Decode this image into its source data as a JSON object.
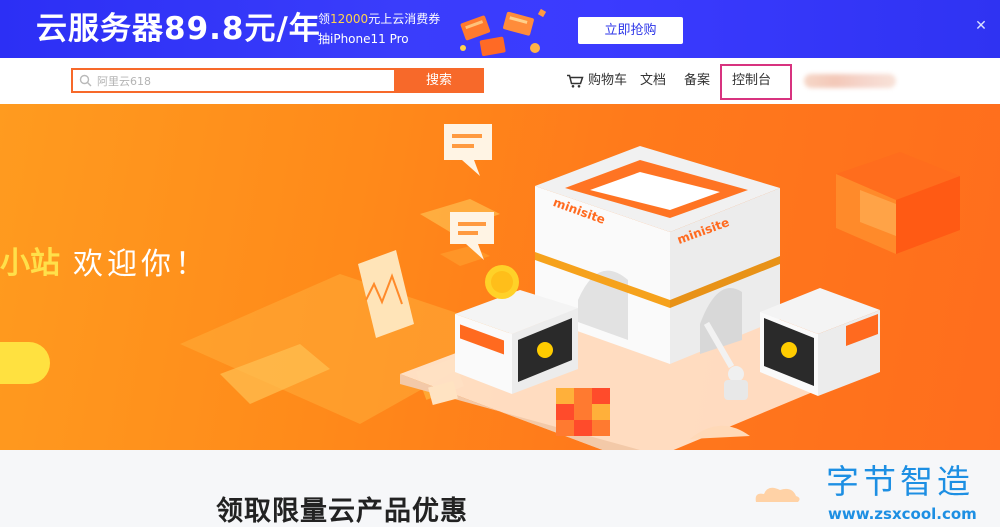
{
  "promo": {
    "title": "云服务器89.8元/年",
    "sub_prefix": "领",
    "sub_highlight": "12000",
    "sub_suffix": "元上云消费券",
    "line2": "抽iPhone11 Pro",
    "cta": "立即抢购",
    "close": "✕"
  },
  "header": {
    "search_placeholder": "阿里云618",
    "search_button": "搜索",
    "cart": "购物车",
    "docs": "文档",
    "icp": "备案",
    "console": "控制台"
  },
  "hero": {
    "title_a": "小站",
    "title_b": "欢迎你！",
    "sign_left": "minisite",
    "sign_right": "minisite"
  },
  "section": {
    "title": "领取限量云产品优惠"
  },
  "watermark": {
    "text": "字节智造",
    "url": "www.zsxcool.com"
  }
}
